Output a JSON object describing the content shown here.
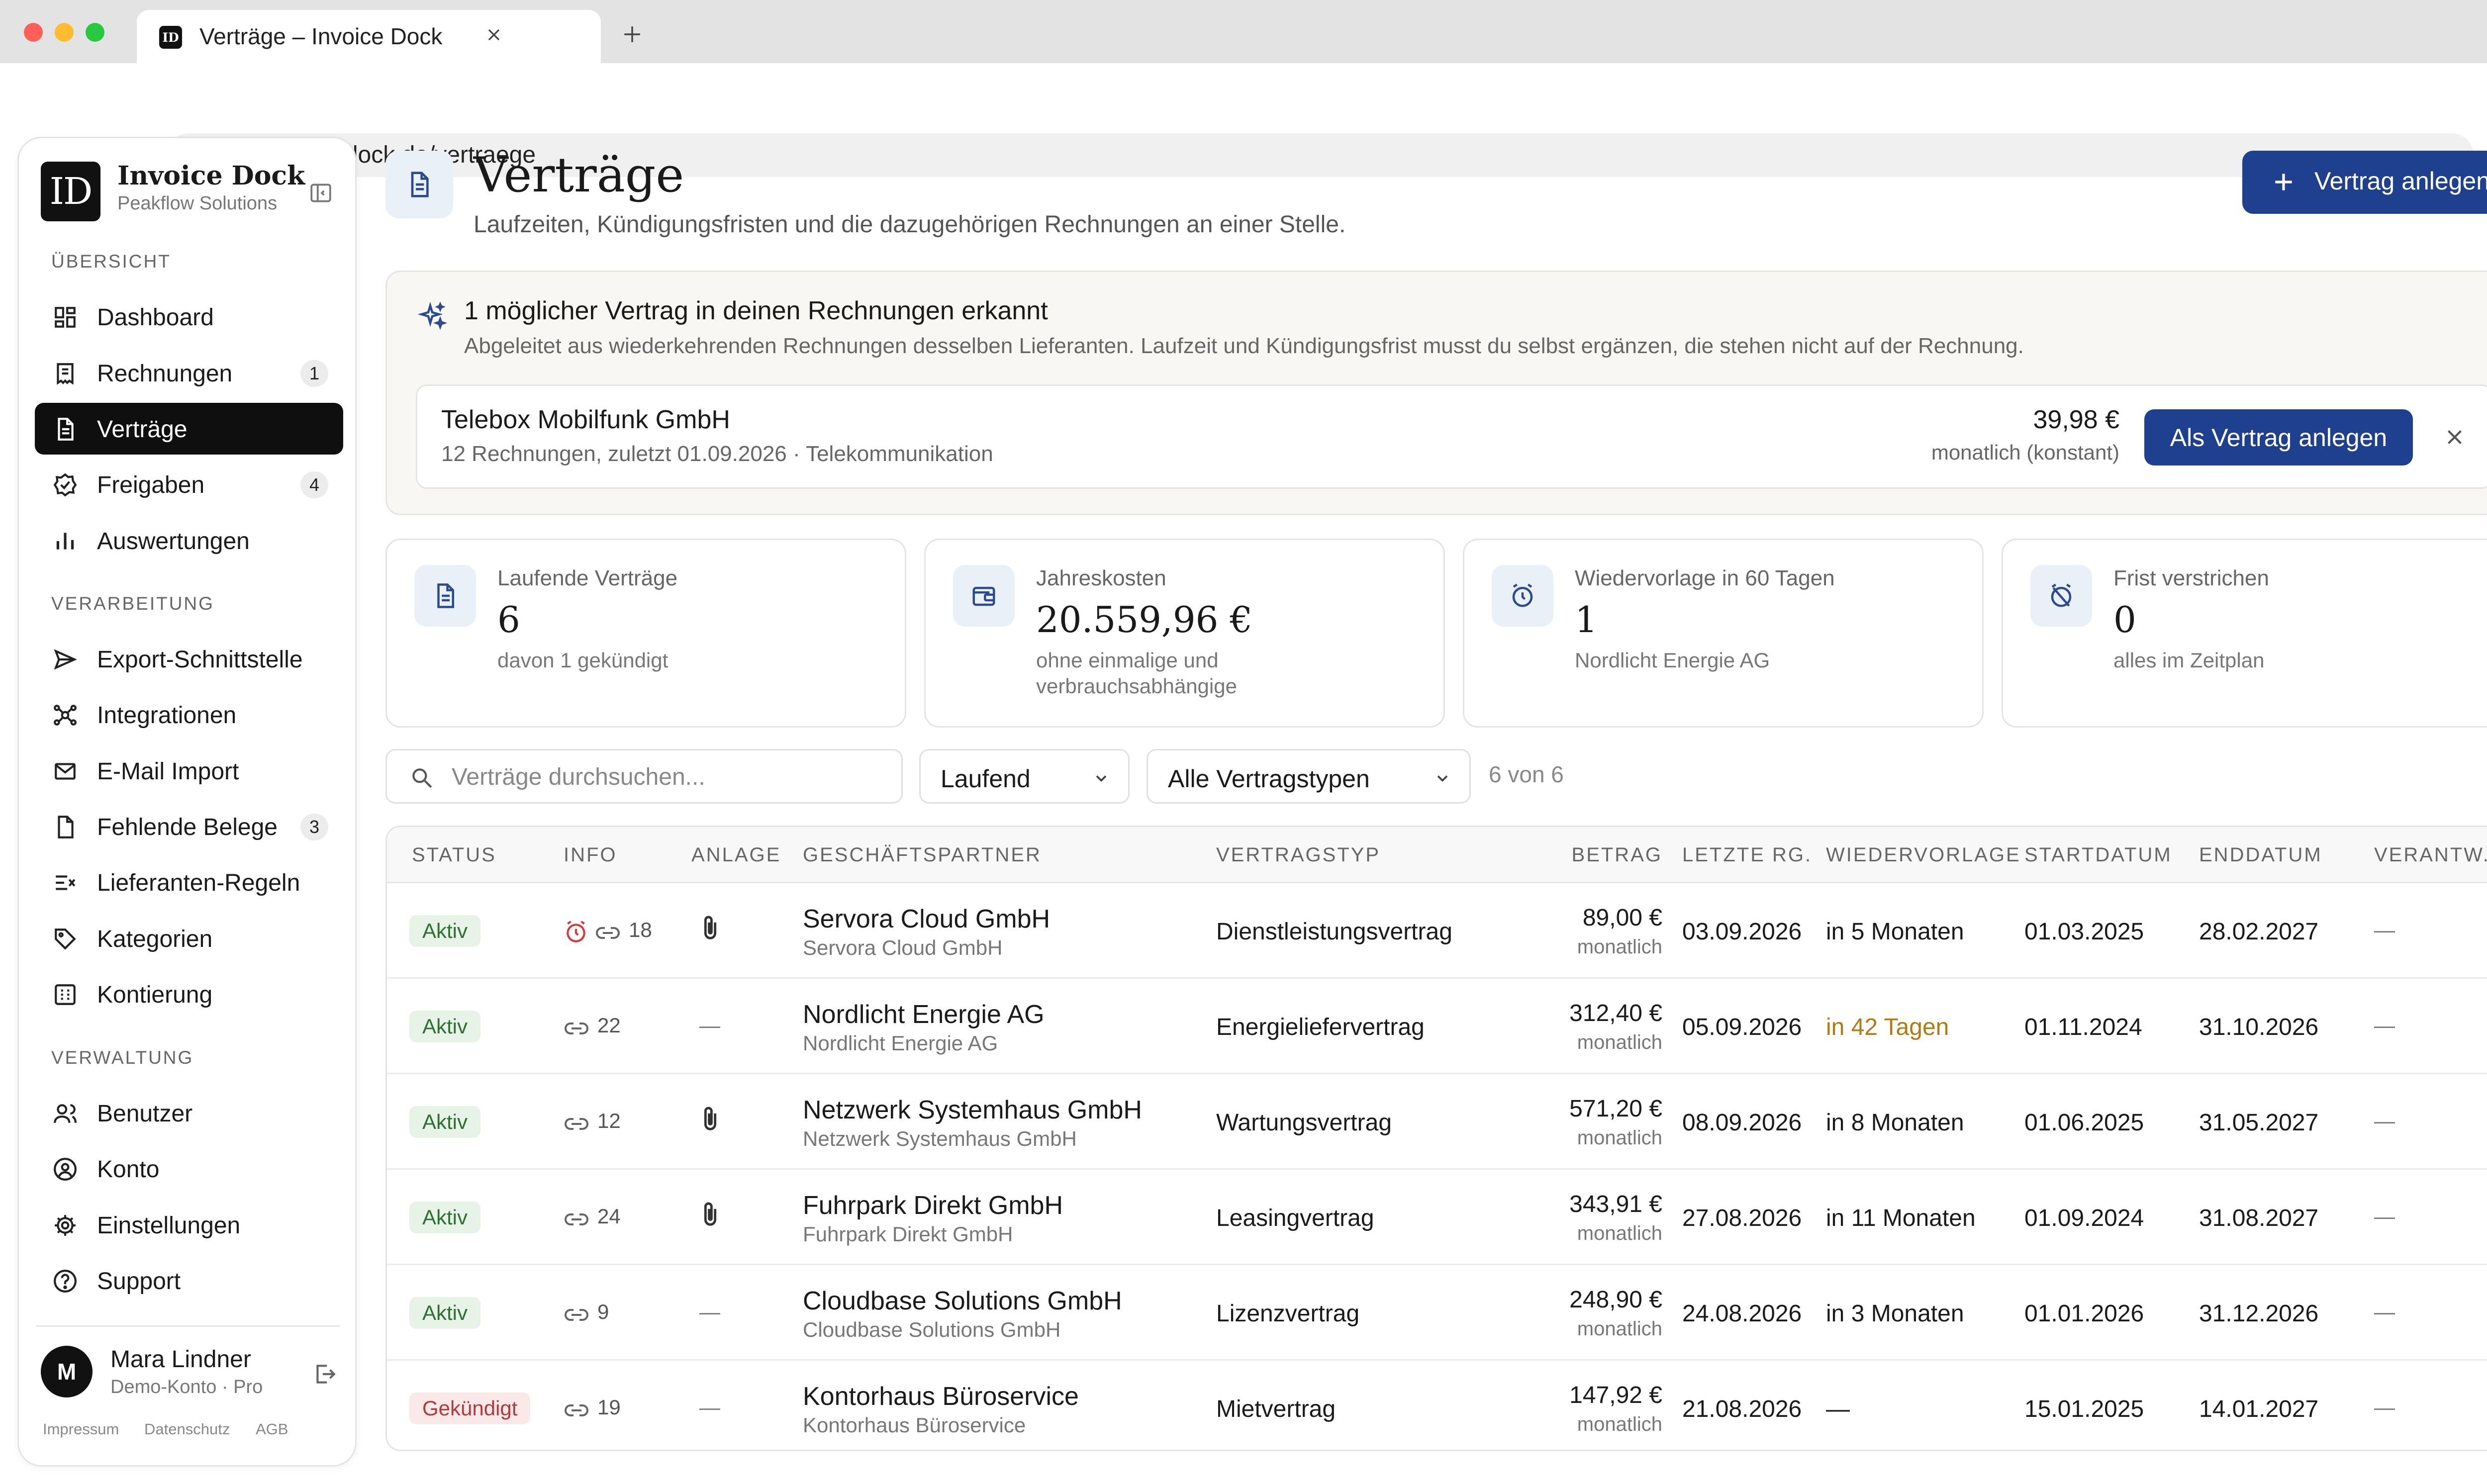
{
  "browser": {
    "tab_title": "Verträge – Invoice Dock",
    "favicon_text": "ID",
    "url": "app.invoicedock.de/vertraege"
  },
  "sidebar": {
    "logo_text": "ID",
    "org_name": "Invoice Dock",
    "org_sub": "Peakflow Solutions",
    "sections": [
      {
        "title": "ÜBERSICHT",
        "items": [
          {
            "label": "Dashboard",
            "icon": "dashboard-icon"
          },
          {
            "label": "Rechnungen",
            "icon": "invoice-icon",
            "badge": "1"
          },
          {
            "label": "Verträge",
            "icon": "contract-icon",
            "active": true
          },
          {
            "label": "Freigaben",
            "icon": "approval-icon",
            "badge": "4"
          },
          {
            "label": "Auswertungen",
            "icon": "bar-chart-icon"
          }
        ]
      },
      {
        "title": "VERARBEITUNG",
        "items": [
          {
            "label": "Export-Schnittstelle",
            "icon": "send-icon"
          },
          {
            "label": "Integrationen",
            "icon": "integrations-icon"
          },
          {
            "label": "E-Mail Import",
            "icon": "mail-icon"
          },
          {
            "label": "Fehlende Belege",
            "icon": "file-icon",
            "badge": "3"
          },
          {
            "label": "Lieferanten-Regeln",
            "icon": "rules-icon"
          },
          {
            "label": "Kategorien",
            "icon": "tag-icon"
          },
          {
            "label": "Kontierung",
            "icon": "ledger-icon"
          }
        ]
      },
      {
        "title": "VERWALTUNG",
        "items": [
          {
            "label": "Benutzer",
            "icon": "users-icon"
          },
          {
            "label": "Konto",
            "icon": "account-icon"
          },
          {
            "label": "Einstellungen",
            "icon": "gear-icon"
          },
          {
            "label": "Support",
            "icon": "help-icon"
          }
        ]
      }
    ],
    "user": {
      "initial": "M",
      "name": "Mara Lindner",
      "plan": "Demo-Konto · Pro"
    },
    "footer_links": [
      "Impressum",
      "Datenschutz",
      "AGB"
    ]
  },
  "header": {
    "title": "Verträge",
    "subtitle": "Laufzeiten, Kündigungsfristen und die dazugehörigen Rechnungen an einer Stelle.",
    "new_button": "Vertrag anlegen"
  },
  "suggestion": {
    "title": "1 möglicher Vertrag in deinen Rechnungen erkannt",
    "subtitle": "Abgeleitet aus wiederkehrenden Rechnungen desselben Lieferanten. Laufzeit und Kündigungsfrist musst du selbst ergänzen, die stehen nicht auf der Rechnung.",
    "vendor": "Telebox Mobilfunk GmbH",
    "meta": "12 Rechnungen, zuletzt 01.09.2026 · Telekommunikation",
    "amount": "39,98 €",
    "period": "monatlich (konstant)",
    "button": "Als Vertrag anlegen"
  },
  "kpis": [
    {
      "label": "Laufende Verträge",
      "value": "6",
      "note": "davon 1 gekündigt",
      "icon": "contract-icon"
    },
    {
      "label": "Jahreskosten",
      "value": "20.559,96 €",
      "note": "ohne einmalige und verbrauchsabhängige",
      "icon": "wallet-icon"
    },
    {
      "label": "Wiedervorlage in 60 Tagen",
      "value": "1",
      "note": "Nordlicht Energie AG",
      "icon": "alarm-icon"
    },
    {
      "label": "Frist verstrichen",
      "value": "0",
      "note": "alles im Zeitplan",
      "icon": "alarm-off-icon"
    }
  ],
  "filters": {
    "search_placeholder": "Verträge durchsuchen...",
    "status_value": "Laufend",
    "type_value": "Alle Vertragstypen",
    "count": "6 von 6"
  },
  "table": {
    "headers": [
      "STATUS",
      "INFO",
      "ANLAGE",
      "GESCHÄFTSPARTNER",
      "VERTRAGSTYP",
      "BETRAG",
      "LETZTE RG.",
      "WIEDERVORLAGE",
      "STARTDATUM",
      "ENDDATUM",
      "VERANTW."
    ],
    "rows": [
      {
        "status": "Aktiv",
        "status_kind": "active",
        "alarm": true,
        "links": "18",
        "attachment": true,
        "partner": "Servora Cloud GmbH",
        "partner_sub": "Servora Cloud GmbH",
        "type": "Dienstleistungsvertrag",
        "amount": "89,00 €",
        "period": "monatlich",
        "last": "03.09.2026",
        "resub": "in 5 Monaten",
        "resub_warn": false,
        "start": "01.03.2025",
        "end": "28.02.2027",
        "resp": "—"
      },
      {
        "status": "Aktiv",
        "status_kind": "active",
        "alarm": false,
        "links": "22",
        "attachment": false,
        "partner": "Nordlicht Energie AG",
        "partner_sub": "Nordlicht Energie AG",
        "type": "Energieliefervertrag",
        "amount": "312,40 €",
        "period": "monatlich",
        "last": "05.09.2026",
        "resub": "in 42 Tagen",
        "resub_warn": true,
        "start": "01.11.2024",
        "end": "31.10.2026",
        "resp": "—"
      },
      {
        "status": "Aktiv",
        "status_kind": "active",
        "alarm": false,
        "links": "12",
        "attachment": true,
        "partner": "Netzwerk Systemhaus GmbH",
        "partner_sub": "Netzwerk Systemhaus GmbH",
        "type": "Wartungsvertrag",
        "amount": "571,20 €",
        "period": "monatlich",
        "last": "08.09.2026",
        "resub": "in 8 Monaten",
        "resub_warn": false,
        "start": "01.06.2025",
        "end": "31.05.2027",
        "resp": "—"
      },
      {
        "status": "Aktiv",
        "status_kind": "active",
        "alarm": false,
        "links": "24",
        "attachment": true,
        "partner": "Fuhrpark Direkt GmbH",
        "partner_sub": "Fuhrpark Direkt GmbH",
        "type": "Leasingvertrag",
        "amount": "343,91 €",
        "period": "monatlich",
        "last": "27.08.2026",
        "resub": "in 11 Monaten",
        "resub_warn": false,
        "start": "01.09.2024",
        "end": "31.08.2027",
        "resp": "—"
      },
      {
        "status": "Aktiv",
        "status_kind": "active",
        "alarm": false,
        "links": "9",
        "attachment": false,
        "partner": "Cloudbase Solutions GmbH",
        "partner_sub": "Cloudbase Solutions GmbH",
        "type": "Lizenzvertrag",
        "amount": "248,90 €",
        "period": "monatlich",
        "last": "24.08.2026",
        "resub": "in 3 Monaten",
        "resub_warn": false,
        "start": "01.01.2026",
        "end": "31.12.2026",
        "resp": "—"
      },
      {
        "status": "Gekündigt",
        "status_kind": "terminated",
        "alarm": false,
        "links": "19",
        "attachment": false,
        "partner": "Kontorhaus Büroservice",
        "partner_sub": "Kontorhaus Büroservice",
        "type": "Mietvertrag",
        "amount": "147,92 €",
        "period": "monatlich",
        "last": "21.08.2026",
        "resub": "—",
        "resub_warn": false,
        "start": "15.01.2025",
        "end": "14.01.2027",
        "resp": "—"
      }
    ]
  },
  "colors": {
    "accent": "#1f3f8f",
    "active_nav": "#0f0f10",
    "success_bg": "#e8f3e7",
    "success_fg": "#2f6f33",
    "danger_bg": "#fbe9e9",
    "danger_fg": "#b33a3a",
    "warning": "#b37a10"
  }
}
